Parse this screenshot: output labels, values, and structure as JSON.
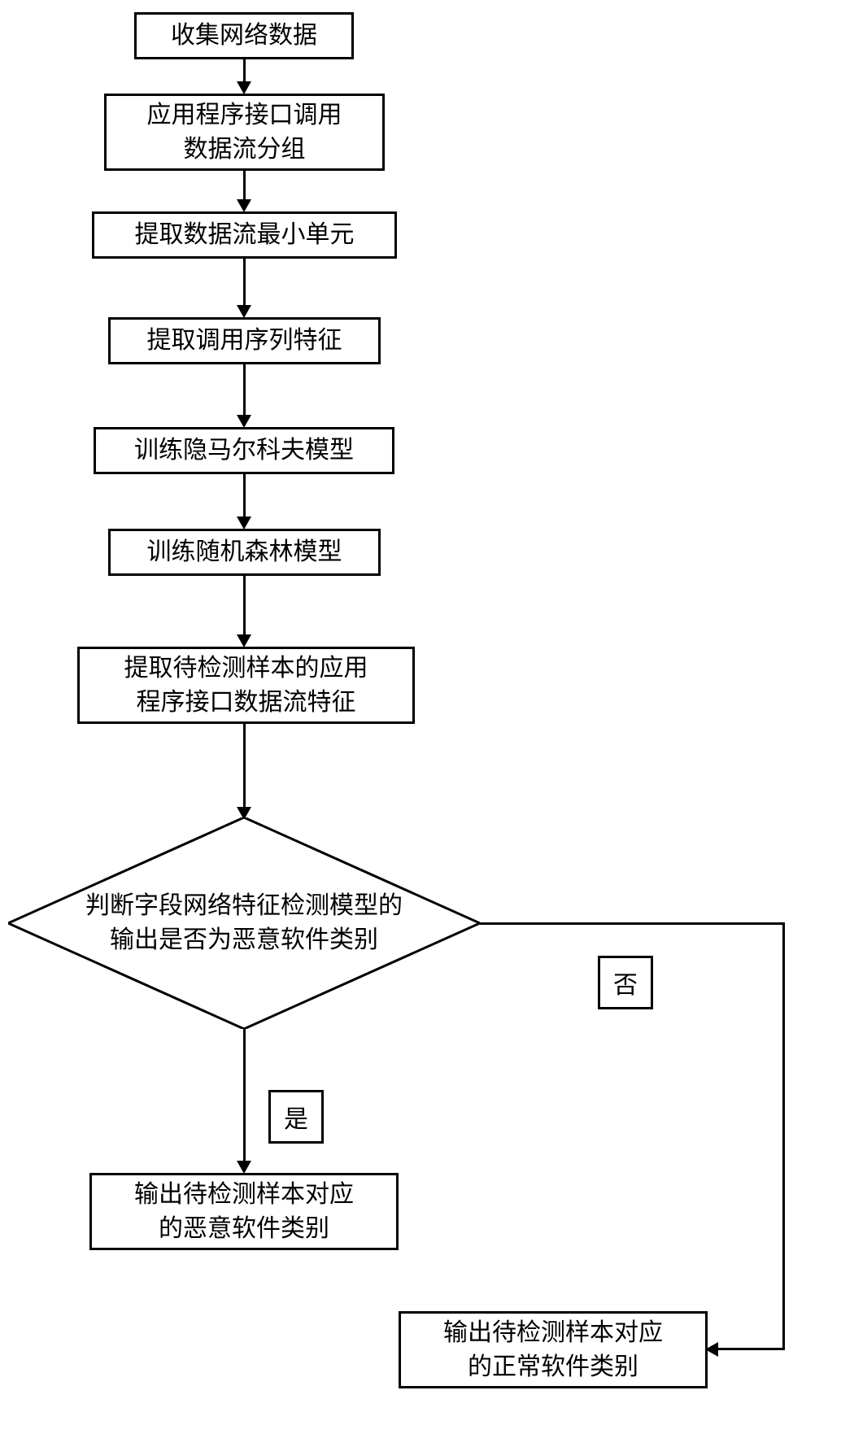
{
  "flowchart": {
    "box1": "收集网络数据",
    "box2": "应用程序接口调用\n数据流分组",
    "box3": "提取数据流最小单元",
    "box4": "提取调用序列特征",
    "box5": "训练隐马尔科夫模型",
    "box6": "训练随机森林模型",
    "box7": "提取待检测样本的应用\n程序接口数据流特征",
    "decision": "判断字段网络特征检测模型的\n输出是否为恶意软件类别",
    "yes_label": "是",
    "no_label": "否",
    "output_yes": "输出待检测样本对应\n的恶意软件类别",
    "output_no": "输出待检测样本对应\n的正常软件类别"
  }
}
